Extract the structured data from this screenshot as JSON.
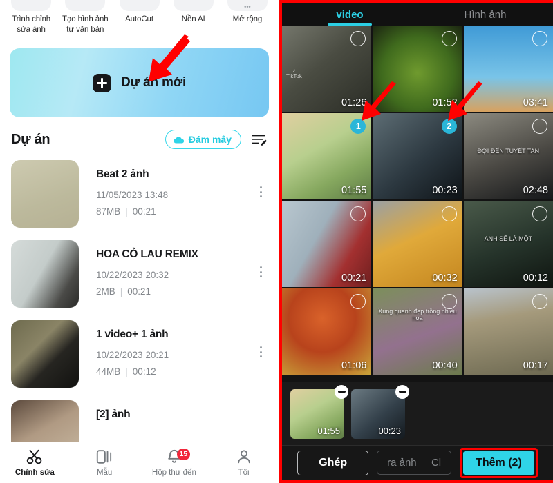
{
  "left": {
    "features": [
      {
        "label": "Trình chỉnh\nsửa ảnh",
        "icon": "image-editor-icon"
      },
      {
        "label": "Tạo hình ảnh\ntừ văn bản",
        "icon": "text-to-image-icon"
      },
      {
        "label": "AutoCut",
        "icon": "autocut-icon"
      },
      {
        "label": "Nền AI",
        "icon": "ai-background-icon"
      },
      {
        "label": "Mở rộng",
        "icon": "expand-icon"
      }
    ],
    "hero": {
      "label": "Dự án mới",
      "icon": "plus-icon"
    },
    "section": {
      "title": "Dự án",
      "cloud_label": "Đám mây",
      "sort_icon": "sort-edit-icon"
    },
    "projects": [
      {
        "name": "Beat 2 ảnh",
        "date": "11/05/2023 13:48",
        "size": "87MB",
        "duration": "00:21",
        "thumb": "#c2bfa4"
      },
      {
        "name": "HOA CỎ LAU REMIX",
        "date": "10/22/2023 20:32",
        "size": "2MB",
        "duration": "00:21",
        "thumb": "#ccd3d2"
      },
      {
        "name": "1 video+ 1 ảnh",
        "date": "10/22/2023 20:21",
        "size": "44MB",
        "duration": "00:12",
        "thumb": "#5c5a4a"
      },
      {
        "name": "[2] ảnh",
        "date": "",
        "size": "",
        "duration": "",
        "thumb": "#9b8d7e"
      }
    ],
    "nav": [
      {
        "label": "Chỉnh sửa",
        "icon": "scissors-icon",
        "active": true,
        "badge": ""
      },
      {
        "label": "Mẫu",
        "icon": "template-icon",
        "active": false,
        "badge": ""
      },
      {
        "label": "Hộp thư đến",
        "icon": "bell-icon",
        "active": false,
        "badge": "15"
      },
      {
        "label": "Tôi",
        "icon": "person-icon",
        "active": false,
        "badge": ""
      }
    ]
  },
  "right": {
    "tabs": [
      {
        "label": "video",
        "active": true
      },
      {
        "label": "Hình ảnh",
        "active": false
      }
    ],
    "media": [
      {
        "duration": "01:26",
        "selected": false,
        "order": "",
        "caption": "",
        "watermark": "TikTok",
        "c1": "#5d5f57",
        "c2": "#2f3128"
      },
      {
        "duration": "01:52",
        "selected": false,
        "order": "",
        "caption": "",
        "watermark": "",
        "c1": "#57782f",
        "c2": "#1d2413"
      },
      {
        "duration": "03:41",
        "selected": false,
        "order": "",
        "caption": "",
        "watermark": "",
        "c1": "#3f9ad6",
        "c2": "#d8a25f"
      },
      {
        "duration": "01:55",
        "selected": true,
        "order": "1",
        "caption": "",
        "watermark": "",
        "c1": "#cdb98a",
        "c2": "#6b8c53"
      },
      {
        "duration": "00:23",
        "selected": true,
        "order": "2",
        "caption": "",
        "watermark": "",
        "c1": "#3d4b51",
        "c2": "#11161a"
      },
      {
        "duration": "02:48",
        "selected": false,
        "order": "",
        "caption": "ĐỢI ĐẾN TUYẾT TAN",
        "watermark": "",
        "c1": "#6b6a62",
        "c2": "#16181a"
      },
      {
        "duration": "00:21",
        "selected": false,
        "order": "",
        "caption": "",
        "watermark": "",
        "c1": "#b8c4cc",
        "c2": "#8d2a2a"
      },
      {
        "duration": "00:32",
        "selected": false,
        "order": "",
        "caption": "",
        "watermark": "",
        "c1": "#d99a2a",
        "c2": "#7b5512"
      },
      {
        "duration": "00:12",
        "selected": false,
        "order": "",
        "caption": "ANH SẼ LÀ MỘT",
        "watermark": "",
        "c1": "#2a3a2c",
        "c2": "#0f1510"
      },
      {
        "duration": "01:06",
        "selected": false,
        "order": "",
        "caption": "",
        "watermark": "",
        "c1": "#c4531f",
        "c2": "#d2b23c"
      },
      {
        "duration": "00:40",
        "selected": false,
        "order": "",
        "caption": "Xung quanh đẹp trồng nhiều hoa",
        "watermark": "",
        "c1": "#6a7d4b",
        "c2": "#9d6f8e"
      },
      {
        "duration": "00:17",
        "selected": false,
        "order": "",
        "caption": "",
        "watermark": "",
        "c1": "#9c8f72",
        "c2": "#5d5a49"
      }
    ],
    "selected_strip": [
      {
        "duration": "01:55",
        "remove_icon": "minus-icon",
        "c1": "#cdb98a",
        "c2": "#6b8c53"
      },
      {
        "duration": "00:23",
        "remove_icon": "minus-icon",
        "c1": "#3d4b51",
        "c2": "#11161a"
      }
    ],
    "actions": {
      "merge_label": "Ghép",
      "ghost_left": "ra ảnh",
      "ghost_right": "Cl",
      "add_label": "Thêm (2)"
    }
  },
  "colors": {
    "accent_cyan": "#2fd4e8",
    "arrow_red": "#ff0000",
    "badge_red": "#f1273b",
    "select_blue": "#2ab6d8"
  }
}
